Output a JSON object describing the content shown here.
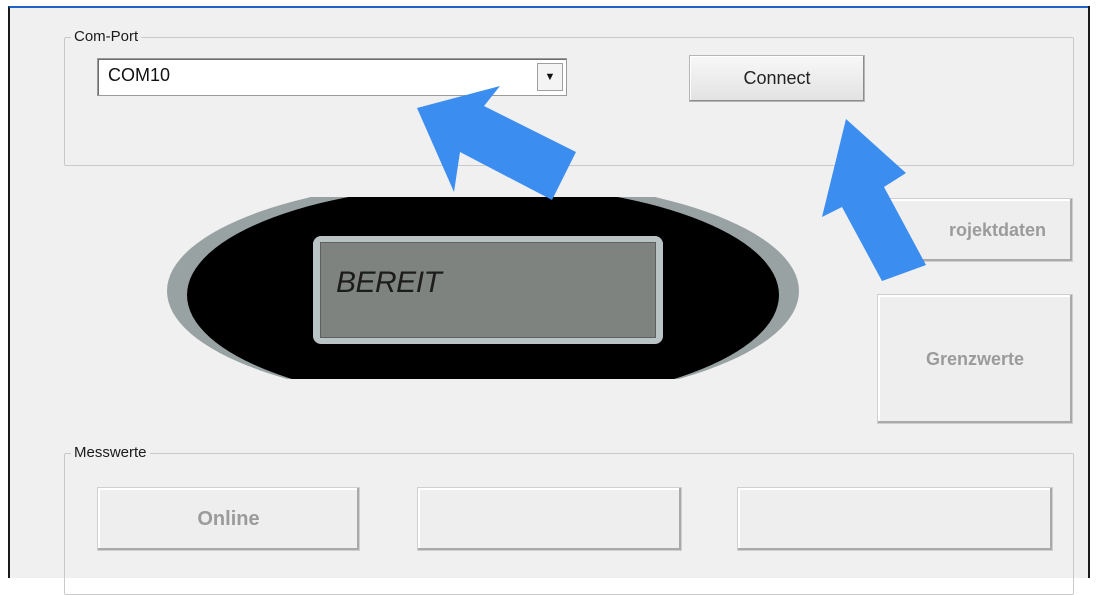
{
  "com_port": {
    "title": "Com-Port",
    "selected_port": "COM10",
    "dropdown_glyph": "▼",
    "connect_label": "Connect"
  },
  "device": {
    "display_text": "BEREIT"
  },
  "side_buttons": {
    "projektdaten_label": "rojektdaten",
    "grenzwerte_label": "Grenzwerte"
  },
  "messwerte": {
    "title": "Messwerte",
    "buttons": [
      "Online",
      "",
      ""
    ]
  },
  "annotations": {
    "arrow_color": "#3b8ef0",
    "arrow_icon": "pointer-arrow-icon"
  }
}
